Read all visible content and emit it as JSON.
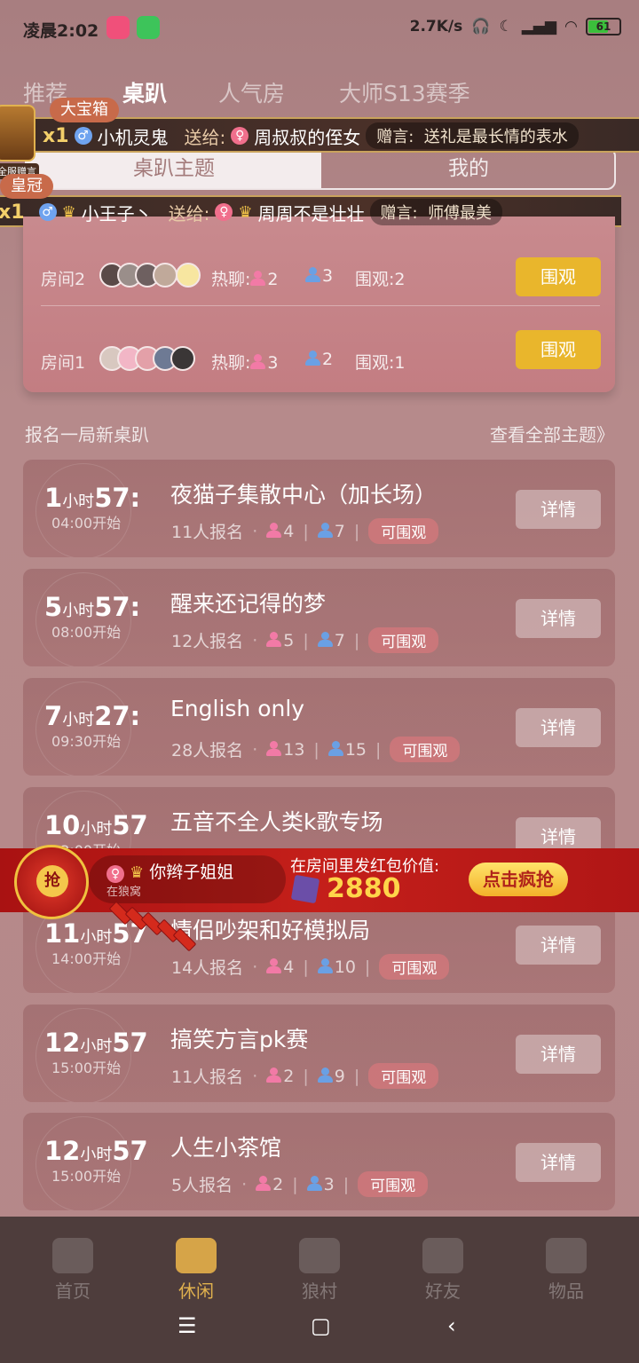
{
  "status_bar": {
    "time": "凌晨2:02",
    "net_speed": "2.7K/s",
    "battery": "61"
  },
  "top_tabs": [
    "推荐",
    "桌趴",
    "人气房",
    "大师S13赛季"
  ],
  "gift_banner_1": {
    "label": "大宝箱",
    "chest_tag": "全服赠言",
    "count": "x1",
    "sender": "小机灵鬼",
    "send_word": "送给:",
    "receiver": "周叔叔的侄女",
    "msg_label": "赠言:",
    "msg": "送礼是最长情的表水"
  },
  "sub_tabs": [
    "桌趴主题",
    "我的"
  ],
  "gift_banner_2": {
    "label": "皇冠",
    "count": "x1",
    "sender": "小王子丶",
    "send_word": "送给:",
    "receiver": "周周不是壮壮",
    "msg_label": "赠言:",
    "msg": "师傅最美"
  },
  "rooms": [
    {
      "name": "房间2",
      "hot_label": "热聊:",
      "female": "2",
      "male": "3",
      "watch": "围观:2",
      "btn": "围观"
    },
    {
      "name": "房间1",
      "hot_label": "热聊:",
      "female": "3",
      "male": "2",
      "watch": "围观:1",
      "btn": "围观"
    }
  ],
  "section": {
    "title": "报名一局新桌趴",
    "link": "查看全部主题》"
  },
  "events": [
    {
      "hours": "1",
      "unit": "小时",
      "mins": "57:",
      "start": "04:00开始",
      "title": "夜猫子集散中心（加长场）",
      "signup": "11人报名",
      "female": "4",
      "male": "7",
      "tag": "可围观",
      "btn": "详情"
    },
    {
      "hours": "5",
      "unit": "小时",
      "mins": "57:",
      "start": "08:00开始",
      "title": "醒来还记得的梦",
      "signup": "12人报名",
      "female": "5",
      "male": "7",
      "tag": "可围观",
      "btn": "详情"
    },
    {
      "hours": "7",
      "unit": "小时",
      "mins": "27:",
      "start": "09:30开始",
      "title": "English only",
      "signup": "28人报名",
      "female": "13",
      "male": "15",
      "tag": "可围观",
      "btn": "详情"
    },
    {
      "hours": "10",
      "unit": "小时",
      "mins": "57",
      "start": "13:00开始",
      "title": "五音不全人类k歌专场",
      "signup": "",
      "female": "",
      "male": "",
      "tag": "",
      "btn": "详情"
    },
    {
      "hours": "11",
      "unit": "小时",
      "mins": "57",
      "start": "14:00开始",
      "title": "情侣吵架和好模拟局",
      "signup": "14人报名",
      "female": "4",
      "male": "10",
      "tag": "可围观",
      "btn": "详情"
    },
    {
      "hours": "12",
      "unit": "小时",
      "mins": "57",
      "start": "15:00开始",
      "title": "搞笑方言pk赛",
      "signup": "11人报名",
      "female": "2",
      "male": "9",
      "tag": "可围观",
      "btn": "详情"
    },
    {
      "hours": "12",
      "unit": "小时",
      "mins": "57",
      "start": "15:00开始",
      "title": "人生小茶馆",
      "signup": "5人报名",
      "female": "2",
      "male": "3",
      "tag": "可围观",
      "btn": "详情"
    }
  ],
  "hongbao": {
    "grab_icon": "抢",
    "user": "你辫子姐姐",
    "user_sub": "在狼窝",
    "info": "在房间里发红包价值:",
    "amount": "2880",
    "button": "点击疯抢"
  },
  "bottom_nav": [
    {
      "label": "首页",
      "icon": "home-icon"
    },
    {
      "label": "休闲",
      "icon": "cup-icon"
    },
    {
      "label": "狼村",
      "icon": "village-icon"
    },
    {
      "label": "好友",
      "icon": "friends-icon"
    },
    {
      "label": "物品",
      "icon": "items-icon"
    }
  ],
  "system_nav": {
    "menu": "☰",
    "home": "▢",
    "back": "‹"
  }
}
